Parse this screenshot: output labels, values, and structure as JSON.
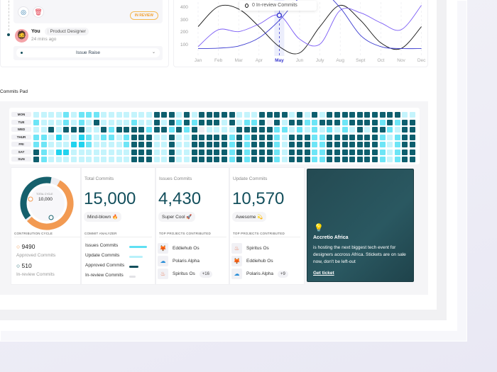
{
  "activity": {
    "status_badge": "IN REVIEW",
    "user": "You",
    "separator": "|",
    "role": "Product Designer",
    "time": "24 mins ago",
    "dropdown": "Issue Raise"
  },
  "chart_data": {
    "type": "line",
    "x": [
      "Jan",
      "Feb",
      "Mar",
      "Apr",
      "May",
      "Jun",
      "July",
      "Aug",
      "Sept",
      "Oct",
      "Nov",
      "Dec"
    ],
    "yticks": [
      100,
      200,
      300,
      400
    ],
    "active": "May",
    "tooltip": "0 In-review Commits",
    "series": [
      {
        "name": "black",
        "color": "#111111",
        "values": [
          250,
          410,
          390,
          250,
          90,
          40,
          250,
          420,
          300,
          120,
          75,
          250
        ]
      },
      {
        "name": "purple",
        "color": "#7b5cf5",
        "values": [
          90,
          225,
          210,
          270,
          340,
          150,
          110,
          380,
          360,
          280,
          225,
          420
        ]
      },
      {
        "name": "blue",
        "color": "#3b3bd0",
        "values": [
          75,
          78,
          95,
          160,
          300,
          480,
          540,
          400,
          180,
          90,
          75,
          75
        ]
      }
    ]
  },
  "commits_pad": {
    "title": "Commits Pad",
    "days": [
      "MON",
      "TUE",
      "WED",
      "THUR",
      "FRI",
      "SAT",
      "SUN"
    ],
    "levels": [
      "111121222111111144414144444111444414141444444444411",
      "211121214111121141424244414122404144224442444424244",
      "114144411424444244242401111444442212121212141442144",
      "221311321221244411411444442424442144422444444421244",
      "221113321111244411411444442424442144422444444421244",
      "421331111111144411411444442424442144422444444421244",
      "421111111111144411411444442424442144422444444421244"
    ],
    "colors": [
      "#efeff3",
      "#c4f4fc",
      "#6de5f6",
      "#22d3ee",
      "#0e5f6e"
    ]
  },
  "cycle": {
    "center_label": "TOTAL CYCLE",
    "total": "10,000",
    "caption": "CONTRIBUTION CYCLE",
    "approved_value": "9490",
    "approved_label": "Approved Commits",
    "review_value": "510",
    "review_label": "In-review Commits",
    "approved_fraction": 0.55
  },
  "total": {
    "label": "Total Commits",
    "value": "15,000",
    "tag": "Mind-blown 🔥",
    "caption": "COMMIT ANALYZER",
    "analyzer": [
      {
        "label": "Issues Commits",
        "color": "#5fe0f3",
        "level": 1.0
      },
      {
        "label": "Update Commits",
        "color": "#b8f1fa",
        "level": 0.75
      },
      {
        "label": "Approved Commits",
        "color": "#134f5c",
        "level": 0.5
      },
      {
        "label": "In-review Commits",
        "color": "#e2e2e6",
        "level": 0.35
      }
    ]
  },
  "issues": {
    "label": "Issues Commits",
    "value": "4,430",
    "tag": "Super Cool 🚀",
    "caption": "TOP PROJECTS CONTRIBUTED",
    "projects": [
      "Eddiehub Os",
      "Polaris Alpha",
      "Spiritus Os"
    ],
    "more": "+16"
  },
  "update": {
    "label": "Update Commits",
    "value": "10,570",
    "tag": "Awesome 💫",
    "caption": "TOP PROJECTS CONTRIBUTED",
    "projects": [
      "Spiritus Os",
      "Eddiehub Os",
      "Polaris Alpha"
    ],
    "more": "+9"
  },
  "promo": {
    "title": "Accretio Africa",
    "body": "is hosting the next biggest tech event for designers accross Africa. Stickets are on sale now, don't be left-out",
    "cta": "Get ticket"
  }
}
